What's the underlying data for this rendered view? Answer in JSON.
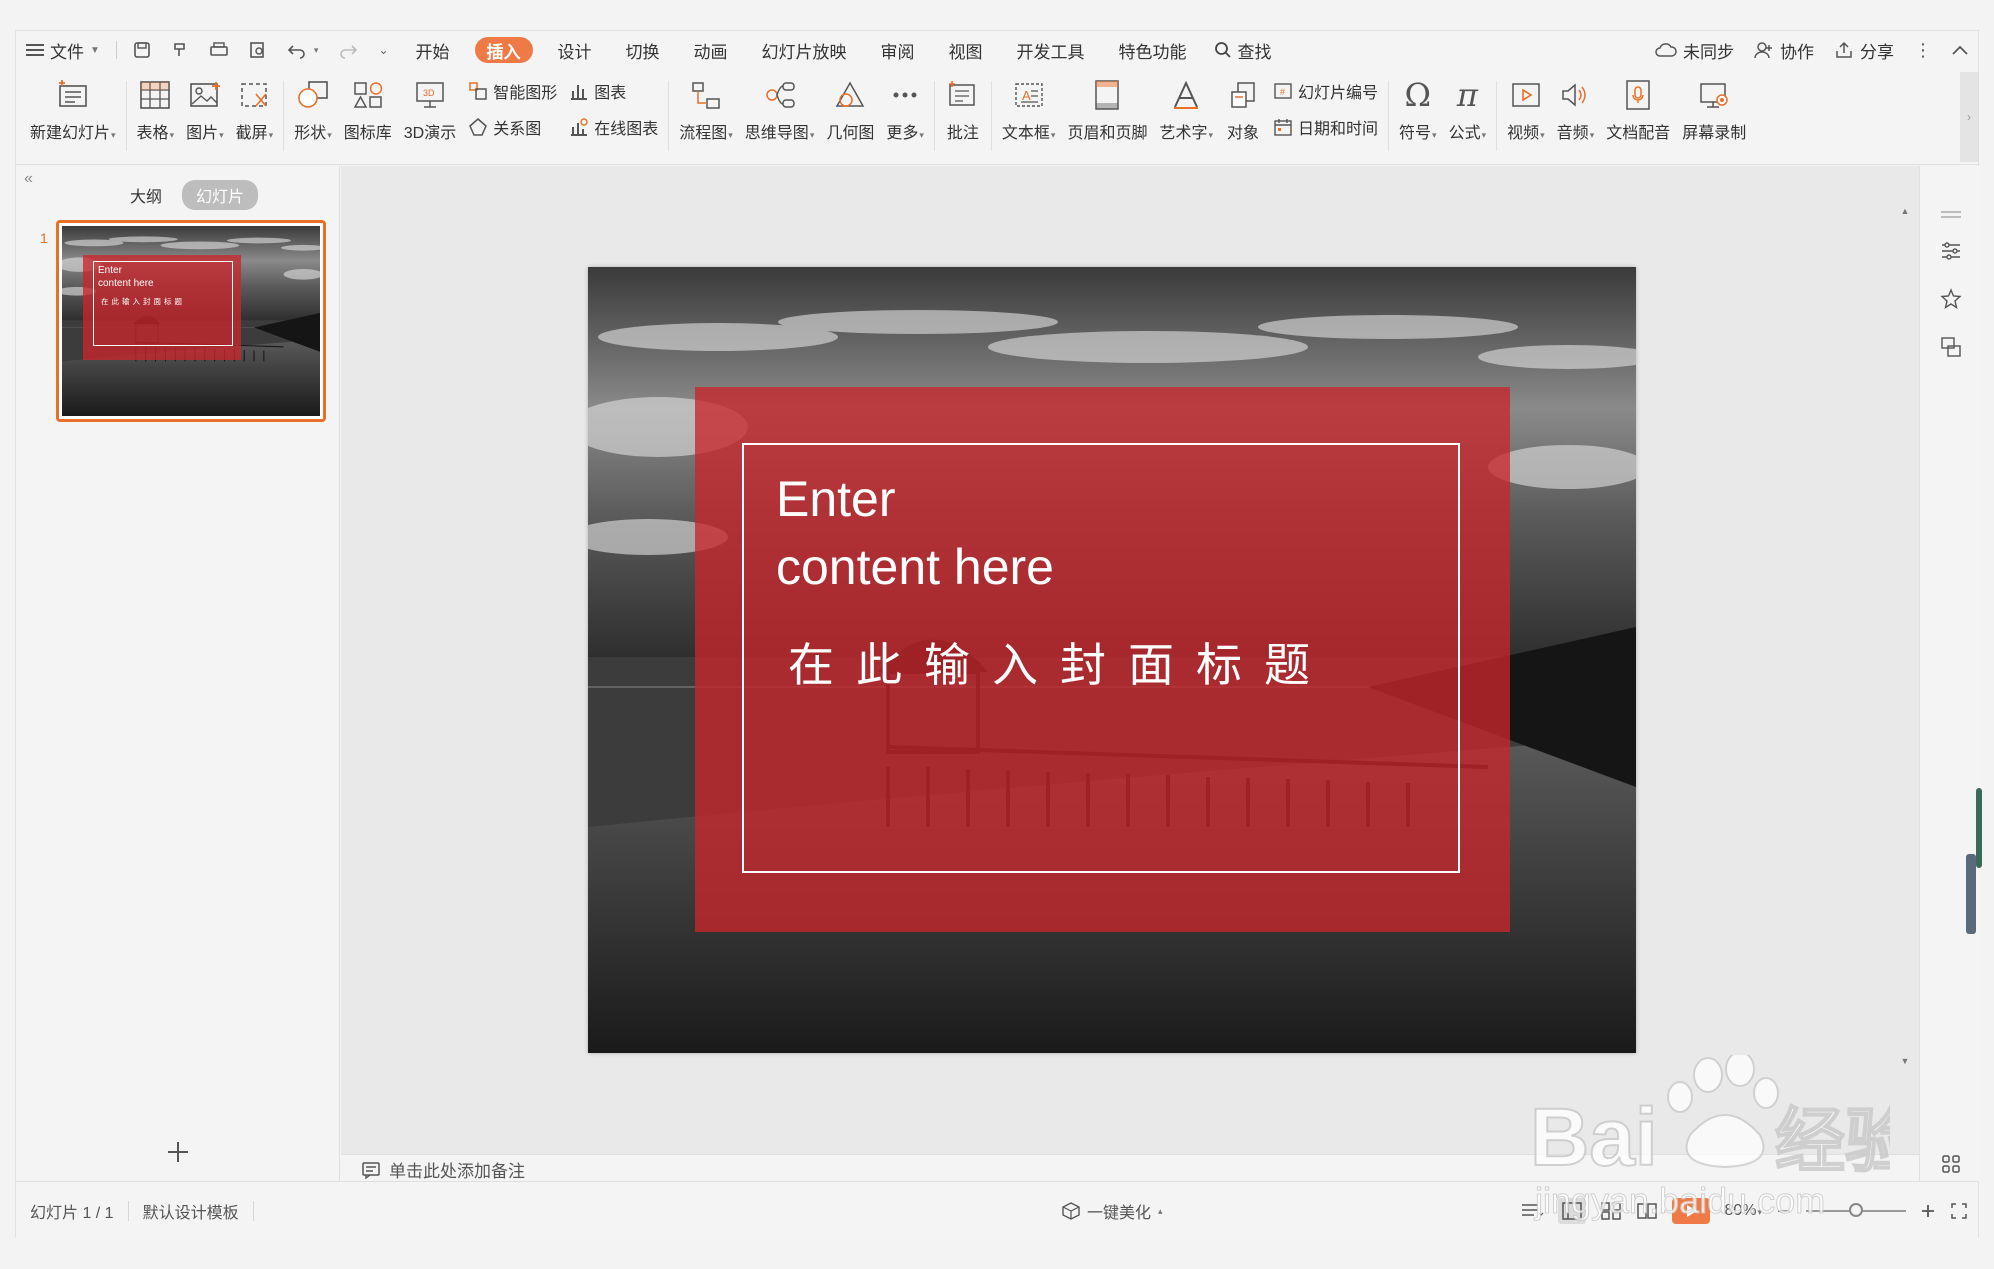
{
  "menubar": {
    "file_label": "文件",
    "tabs": [
      "开始",
      "插入",
      "设计",
      "切换",
      "动画",
      "幻灯片放映",
      "审阅",
      "视图",
      "开发工具",
      "特色功能"
    ],
    "active_tab": "插入",
    "search_label": "查找",
    "sync_label": "未同步",
    "collab_label": "协作",
    "share_label": "分享"
  },
  "ribbon": {
    "new_slide": "新建幻灯片",
    "table": "表格",
    "picture": "图片",
    "screenshot": "截屏",
    "shape": "形状",
    "icon_lib": "图标库",
    "demo3d": "3D演示",
    "smart_shape": "智能图形",
    "chart": "图表",
    "relation": "关系图",
    "online_chart": "在线图表",
    "flowchart": "流程图",
    "mindmap": "思维导图",
    "geometry": "几何图",
    "more": "更多",
    "comment": "批注",
    "textbox": "文本框",
    "header_footer": "页眉和页脚",
    "wordart": "艺术字",
    "object": "对象",
    "slide_number": "幻灯片编号",
    "date_time": "日期和时间",
    "symbol": "符号",
    "formula": "公式",
    "video": "视频",
    "audio": "音频",
    "doc_voice": "文档配音",
    "screen_record": "屏幕录制"
  },
  "leftpanel": {
    "tab_outline": "大纲",
    "tab_slides": "幻灯片",
    "slide_number": "1"
  },
  "slide": {
    "title_line1": "Enter",
    "title_line2": "content here",
    "subtitle": "在此输入封面标题"
  },
  "notes_placeholder": "单击此处添加备注",
  "statusbar": {
    "slide_counter": "幻灯片 1 / 1",
    "template": "默认设计模板",
    "beautify": "一键美化",
    "zoom": "80%"
  },
  "colors": {
    "accent": "#f07a45",
    "slide_overlay": "#c8262c"
  }
}
